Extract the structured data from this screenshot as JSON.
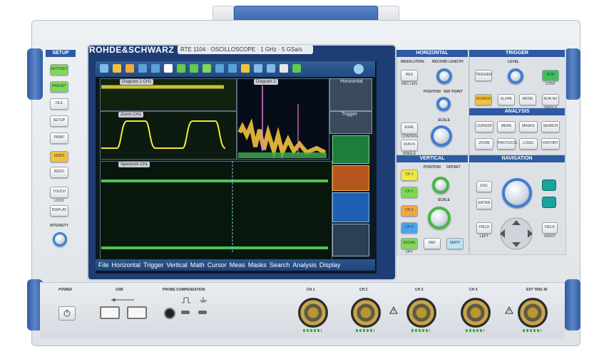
{
  "brand": {
    "logo_text": "ROHDE&SCHWARZ",
    "model_label": "RTE 1104  ·  OSCILLOSCOPE  ·  1 GHz  ·  5 GSa/s"
  },
  "setup": {
    "title": "SETUP",
    "buttons": [
      "AUTOSET",
      "PRESET",
      "FILE",
      "SETUP",
      "PRINT",
      "UNDO",
      "REDO",
      "TOUCH LOCK",
      "DISPLAY"
    ],
    "intensity_label": "INTENSITY"
  },
  "screen": {
    "menu": [
      "File",
      "Horizontal",
      "Trigger",
      "Vertical",
      "Math",
      "Cursor",
      "Meas",
      "Masks",
      "Search",
      "Analysis",
      "Display"
    ],
    "pane_tags": [
      "Diagram 1 CH1",
      "Diagram 2",
      "Zoom CH1",
      "Spectrum Ch1"
    ],
    "info_horizontal": "Horizontal",
    "info_trigger": "Trigger"
  },
  "horizontal": {
    "title": "HORIZONTAL",
    "labels": [
      "RESOLUTION",
      "RECORD LENGTH",
      "POSITION",
      "REF POINT",
      "SCALE"
    ],
    "buttons": [
      "RES REC LEN",
      "SGML CONTROL",
      "RUN N SINGLE"
    ]
  },
  "trigger": {
    "title": "TRIGGER",
    "level_label": "LEVEL",
    "buttons": [
      "TRIGGER",
      "RUN CONT",
      "SOURCE",
      "SLOPE",
      "MODE",
      "RUN NX SINGLE"
    ]
  },
  "analysis": {
    "title": "ANALYSIS",
    "buttons": [
      "CURSOR",
      "MEAS",
      "MASKS",
      "SEARCH",
      "ZOOM",
      "PROTOCOL",
      "LOGIC",
      "HISTORY"
    ]
  },
  "vertical": {
    "title": "VERTICAL",
    "channels": [
      "CH 1",
      "CH 2",
      "CH 3",
      "CH 4"
    ],
    "labels": [
      "POSITION",
      "OFFSET",
      "SCALE"
    ],
    "buttons": [
      "SIGNAL OFF",
      "REF",
      "MATH"
    ]
  },
  "navigation": {
    "title": "NAVIGATION",
    "buttons": [
      "ESC",
      "ENTER",
      "FIELD LEFT",
      "FIELD RIGHT"
    ]
  },
  "lower": {
    "power": "POWER",
    "usb": "USB",
    "probe": "PROBE COMPENSATION",
    "inputs": [
      "CH 1",
      "CH 2",
      "CH 3",
      "CH 4",
      "EXT TRIG IN"
    ]
  },
  "colors": {
    "accent": "#2d5aa3",
    "ch1": "#f2ea3a",
    "ch2": "#7ed957",
    "ch3": "#f4a640",
    "ch4": "#4aa3e8",
    "screen_bg": "#0b1a22"
  },
  "icons": [
    "power-icon",
    "usb-icon",
    "warning-icon",
    "ground-icon",
    "square-wave-icon"
  ]
}
